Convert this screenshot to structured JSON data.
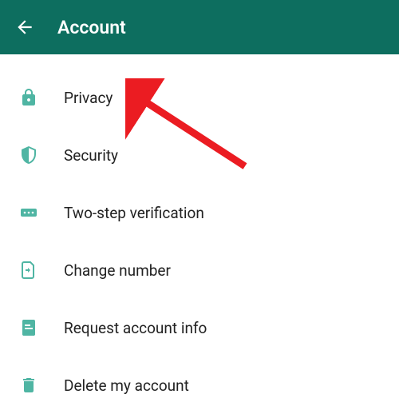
{
  "header": {
    "title": "Account"
  },
  "menu": {
    "items": [
      {
        "label": "Privacy",
        "icon": "lock-icon"
      },
      {
        "label": "Security",
        "icon": "shield-icon"
      },
      {
        "label": "Two-step verification",
        "icon": "pin-icon"
      },
      {
        "label": "Change number",
        "icon": "sim-swap-icon"
      },
      {
        "label": "Request account info",
        "icon": "document-icon"
      },
      {
        "label": "Delete my account",
        "icon": "trash-icon"
      }
    ]
  },
  "colors": {
    "header_bg": "#0d6e5f",
    "icon": "#4fb5a3",
    "annotation": "#eb1c22"
  }
}
